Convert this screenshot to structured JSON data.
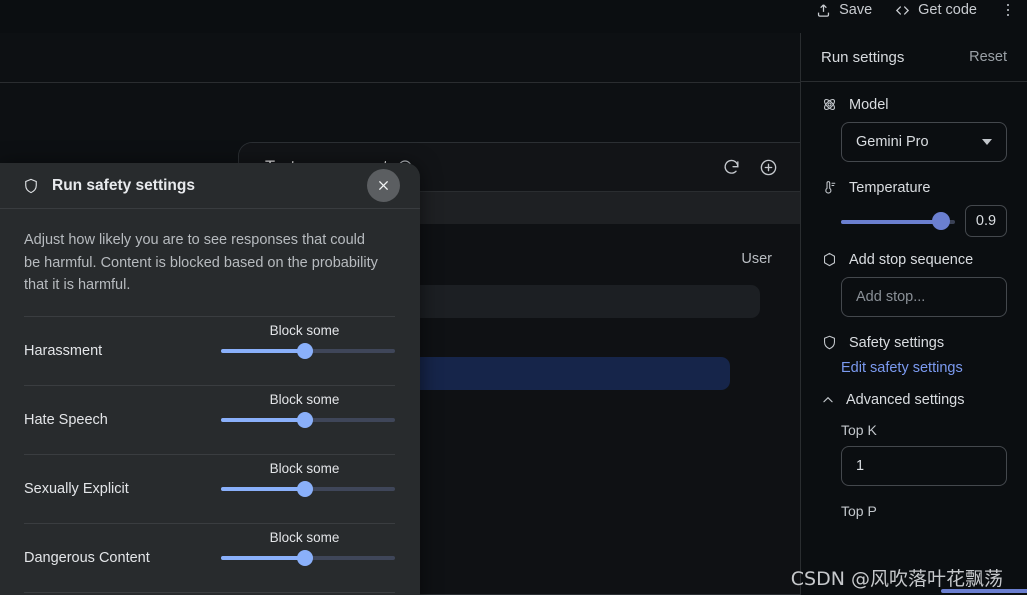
{
  "toolbar": {
    "save_label": "Save",
    "get_code_label": "Get code",
    "save_icon": "save-icon",
    "code_icon": "code-brackets-icon",
    "more_icon": "more-vertical-icon"
  },
  "prompt_panel": {
    "title": "Test your prompt",
    "info_icon": "info-circle-icon",
    "refresh_icon": "refresh-icon",
    "add_icon": "plus-circle-icon",
    "user_label": "User"
  },
  "run_settings": {
    "title": "Run settings",
    "reset_label": "Reset",
    "model": {
      "icon": "model-atom-icon",
      "label": "Model",
      "value": "Gemini Pro"
    },
    "temperature": {
      "icon": "temperature-icon",
      "label": "Temperature",
      "value": "0.9",
      "fill_percent": 88
    },
    "stop_sequence": {
      "icon": "hexagon-icon",
      "label": "Add stop sequence",
      "placeholder": "Add stop..."
    },
    "safety": {
      "icon": "shield-icon",
      "label": "Safety settings",
      "edit_link": "Edit safety settings"
    },
    "advanced": {
      "icon": "chevron-up-icon",
      "label": "Advanced settings",
      "top_k_label": "Top K",
      "top_k_value": "1",
      "top_p_label": "Top P"
    }
  },
  "safety_dialog": {
    "icon": "shield-icon",
    "title": "Run safety settings",
    "close_icon": "close-icon",
    "description": "Adjust how likely you are to see responses that could be harmful. Content is blocked based on the probability that it is harmful.",
    "rows": [
      {
        "name": "Harassment",
        "value": "Block some",
        "fill_percent": 48
      },
      {
        "name": "Hate Speech",
        "value": "Block some",
        "fill_percent": 48
      },
      {
        "name": "Sexually Explicit",
        "value": "Block some",
        "fill_percent": 48
      },
      {
        "name": "Dangerous Content",
        "value": "Block some",
        "fill_percent": 48
      }
    ]
  },
  "watermark": {
    "text": "CSDN @风吹落叶花飘荡"
  },
  "colors": {
    "accent_blue": "#8ab0fa",
    "sidebar_slider": "#6b7fd0",
    "link_blue": "#7b9af0",
    "dialog_bg": "#282b2d",
    "page_bg": "#0b0e11",
    "highlight_row": "#16254a"
  }
}
